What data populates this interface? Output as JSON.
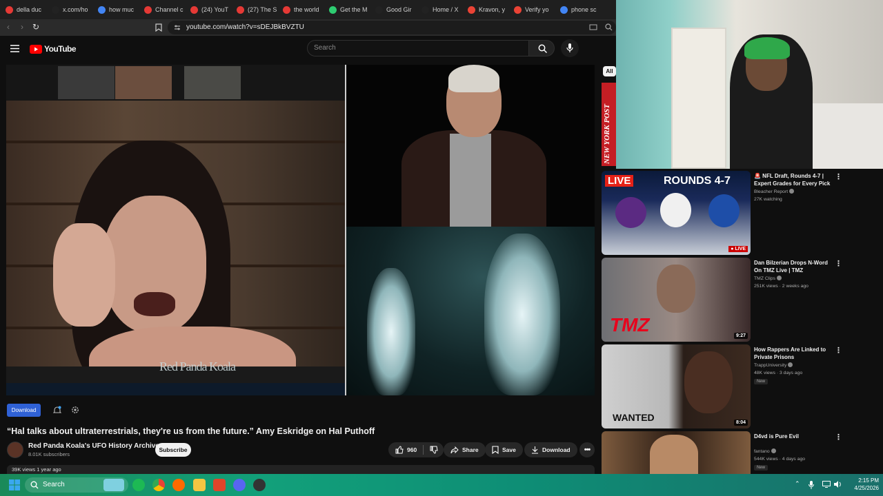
{
  "browser": {
    "tabs": [
      {
        "label": "della duc",
        "color": "#e53935"
      },
      {
        "label": "x.com/ho",
        "color": "#222222"
      },
      {
        "label": "how muc",
        "color": "#4285f4"
      },
      {
        "label": "Channel c",
        "color": "#e53935"
      },
      {
        "label": "(24) YouT",
        "color": "#e53935"
      },
      {
        "label": "(27) The S",
        "color": "#e53935"
      },
      {
        "label": "the world",
        "color": "#e53935"
      },
      {
        "label": "Get the M",
        "color": "#2ecc71"
      },
      {
        "label": "Good Gir",
        "color": "#222222"
      },
      {
        "label": "Home / X",
        "color": "#222222"
      },
      {
        "label": "Kravon, y",
        "color": "#ea4335"
      },
      {
        "label": "Verify yo",
        "color": "#ea4335"
      },
      {
        "label": "phone sc",
        "color": "#4285f4"
      }
    ],
    "url": "youtube.com/watch?v=sDEJBkBVZTU"
  },
  "youtube": {
    "logo_text": "YouTube",
    "search_placeholder": "Search"
  },
  "video": {
    "watermark": "Red Panda Koala",
    "download_label": "Download",
    "title": "“Hal talks about ultraterrestrials, they're us from the future.” Amy Eskridge on Hal Puthoff",
    "channel_name": "Red Panda Koala's UFO History Archive",
    "subscribers": "8.01K subscribers",
    "subscribe_label": "Subscribe",
    "likes": "960",
    "share_label": "Share",
    "save_label": "Save",
    "download_action_label": "Download",
    "description_meta": "39K views  1 year ago"
  },
  "sidebar": {
    "chip_all": "All",
    "nyp_text": "NEW YORK POST",
    "recommendations": [
      {
        "title": "🚨 NFL Draft, Rounds 4-7 | Expert Grades for Every Pick",
        "channel": "Bleacher Report",
        "meta": "27K watching",
        "badge": "LIVE",
        "thumb_text": "LIVE  ROUNDS 4-7",
        "duration": ""
      },
      {
        "title": "Dan Bilzerian Drops N-Word On TMZ Live | TMZ",
        "channel": "TMZ Clips",
        "meta": "251K views · 2 weeks ago",
        "badge": "",
        "thumb_text": "TMZ",
        "duration": "9:27"
      },
      {
        "title": "How Rappers Are Linked to Private Prisons",
        "channel": "TrappUniversity",
        "meta": "48K views · 3 days ago",
        "badge": "New",
        "thumb_text": "WANTED",
        "duration": "8:04"
      },
      {
        "title": "D4vd is Pure Evil",
        "channel": "fantano",
        "meta": "544K views · 4 days ago",
        "badge": "New",
        "thumb_text": "",
        "duration": ""
      }
    ]
  },
  "taskbar": {
    "search_label": "Search",
    "time": "2:15 PM",
    "date": "4/25/2026"
  }
}
